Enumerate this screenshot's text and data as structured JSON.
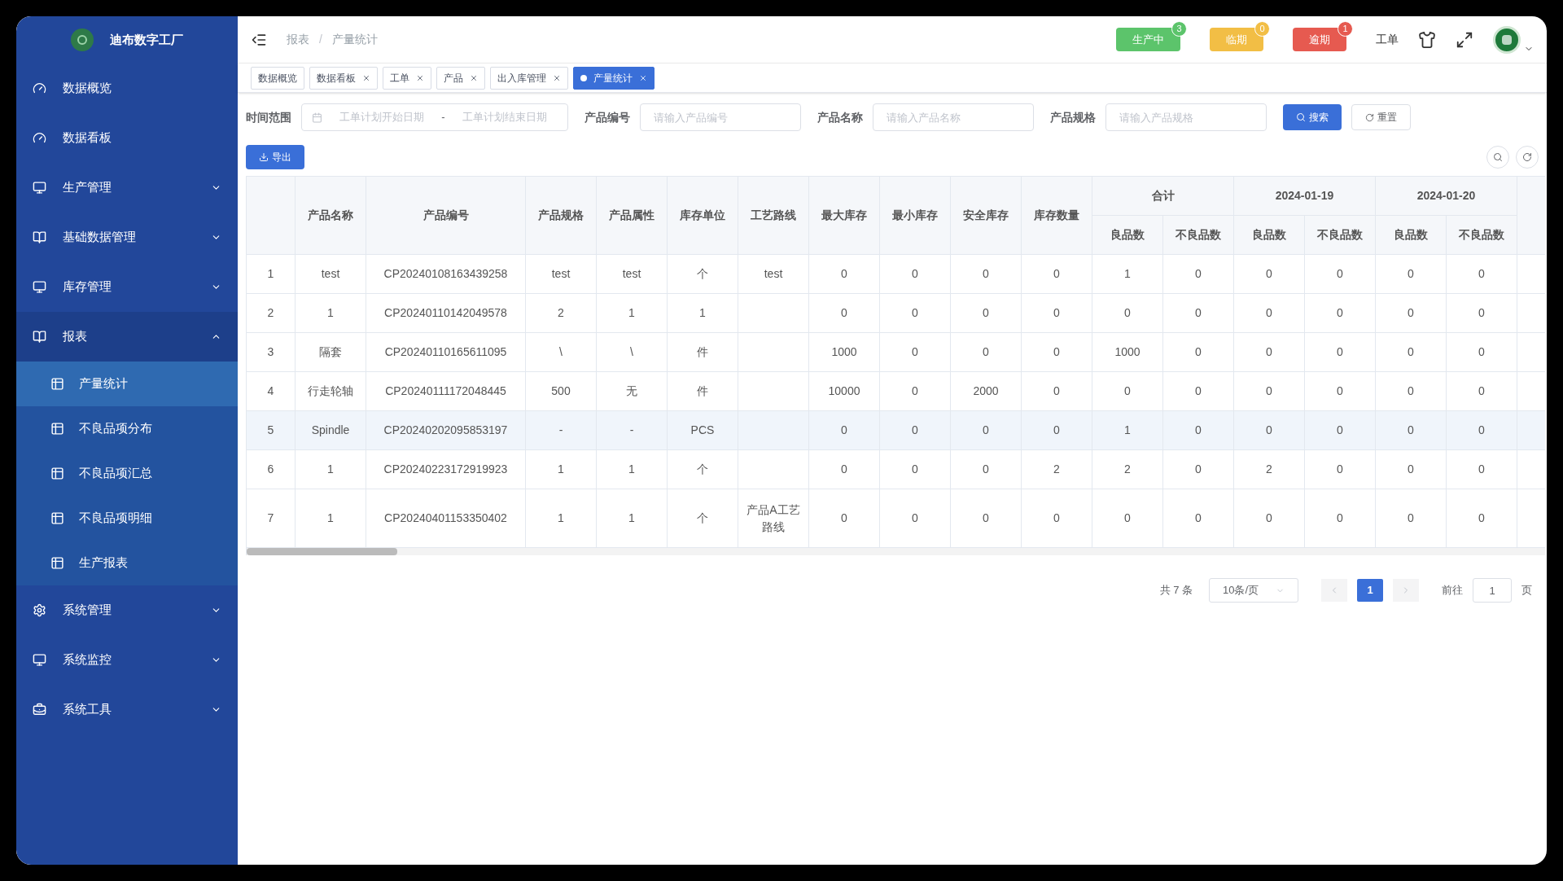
{
  "sidebar": {
    "title": "迪布数字工厂",
    "items": [
      {
        "label": "数据概览",
        "kind": "link"
      },
      {
        "label": "数据看板",
        "kind": "link"
      },
      {
        "label": "生产管理",
        "kind": "group",
        "expanded": false
      },
      {
        "label": "基础数据管理",
        "kind": "group",
        "expanded": false
      },
      {
        "label": "库存管理",
        "kind": "group",
        "expanded": false
      },
      {
        "label": "报表",
        "kind": "group",
        "expanded": true,
        "children": [
          {
            "label": "产量统计",
            "selected": true
          },
          {
            "label": "不良品项分布",
            "selected": false
          },
          {
            "label": "不良品项汇总",
            "selected": false
          },
          {
            "label": "不良品项明细",
            "selected": false
          },
          {
            "label": "生产报表",
            "selected": false
          }
        ]
      },
      {
        "label": "系统管理",
        "kind": "group",
        "expanded": false
      },
      {
        "label": "系统监控",
        "kind": "group",
        "expanded": false
      },
      {
        "label": "系统工具",
        "kind": "group",
        "expanded": false
      }
    ]
  },
  "breadcrumb": [
    "报表",
    "产量统计"
  ],
  "breadcrumb_separator": "/",
  "status_buttons": [
    {
      "label": "生产中",
      "count": "3",
      "color": "#5cc46b"
    },
    {
      "label": "临期",
      "count": "0",
      "color": "#f2be45"
    },
    {
      "label": "逾期",
      "count": "1",
      "color": "#e65a50"
    }
  ],
  "header_link": "工单",
  "tabs": [
    {
      "label": "数据概览",
      "closable": false,
      "selected": false
    },
    {
      "label": "数据看板",
      "closable": true,
      "selected": false
    },
    {
      "label": "工单",
      "closable": true,
      "selected": false
    },
    {
      "label": "产品",
      "closable": true,
      "selected": false
    },
    {
      "label": "出入库管理",
      "closable": true,
      "selected": false
    },
    {
      "label": "产量统计",
      "closable": true,
      "selected": true
    }
  ],
  "filters": {
    "time_label": "时间范围",
    "start_placeholder": "工单计划开始日期",
    "separator": "-",
    "end_placeholder": "工单计划结束日期",
    "fields": [
      {
        "label": "产品编号",
        "placeholder": "请输入产品编号"
      },
      {
        "label": "产品名称",
        "placeholder": "请输入产品名称"
      },
      {
        "label": "产品规格",
        "placeholder": "请输入产品规格"
      }
    ],
    "search_button": "搜索",
    "reset_button": "重置"
  },
  "export_button": "导出",
  "table": {
    "columns": [
      "",
      "产品名称",
      "产品编号",
      "产品规格",
      "产品属性",
      "库存单位",
      "工艺路线",
      "最大库存",
      "最小库存",
      "安全库存",
      "库存数量"
    ],
    "groups": [
      {
        "title": "合计",
        "sub": [
          "良品数",
          "不良品数"
        ]
      },
      {
        "title": "2024-01-19",
        "sub": [
          "良品数",
          "不良品数"
        ]
      },
      {
        "title": "2024-01-20",
        "sub": [
          "良品数",
          "不良品数"
        ]
      }
    ],
    "rows": [
      {
        "highlighted": false,
        "cells": [
          "1",
          "test",
          "CP20240108163439258",
          "test",
          "test",
          "个",
          "test",
          "0",
          "0",
          "0",
          "0",
          "1",
          "0",
          "0",
          "0",
          "0",
          "0"
        ]
      },
      {
        "highlighted": false,
        "cells": [
          "2",
          "1",
          "CP20240110142049578",
          "2",
          "1",
          "1",
          "",
          "0",
          "0",
          "0",
          "0",
          "0",
          "0",
          "0",
          "0",
          "0",
          "0"
        ]
      },
      {
        "highlighted": false,
        "cells": [
          "3",
          "隔套",
          "CP20240110165611095",
          "\\",
          "\\",
          "件",
          "",
          "1000",
          "0",
          "0",
          "0",
          "1000",
          "0",
          "0",
          "0",
          "0",
          "0"
        ]
      },
      {
        "highlighted": false,
        "cells": [
          "4",
          "行走轮轴",
          "CP20240111172048445",
          "500",
          "无",
          "件",
          "",
          "10000",
          "0",
          "2000",
          "0",
          "0",
          "0",
          "0",
          "0",
          "0",
          "0"
        ]
      },
      {
        "highlighted": true,
        "cells": [
          "5",
          "Spindle",
          "CP20240202095853197",
          "-",
          "-",
          "PCS",
          "",
          "0",
          "0",
          "0",
          "0",
          "1",
          "0",
          "0",
          "0",
          "0",
          "0"
        ]
      },
      {
        "highlighted": false,
        "cells": [
          "6",
          "1",
          "CP20240223172919923",
          "1",
          "1",
          "个",
          "",
          "0",
          "0",
          "0",
          "2",
          "2",
          "0",
          "2",
          "0",
          "0",
          "0"
        ]
      },
      {
        "highlighted": false,
        "cells": [
          "7",
          "1",
          "CP20240401153350402",
          "1",
          "1",
          "个",
          "产品A工艺路线",
          "0",
          "0",
          "0",
          "0",
          "0",
          "0",
          "0",
          "0",
          "0",
          "0"
        ]
      }
    ]
  },
  "pagination": {
    "total": "共 7 条",
    "page_size": "10条/页",
    "pages": [
      {
        "label": "1",
        "selected": true
      }
    ],
    "goto_label": "前往",
    "goto_value": "1",
    "goto_suffix": "页"
  }
}
